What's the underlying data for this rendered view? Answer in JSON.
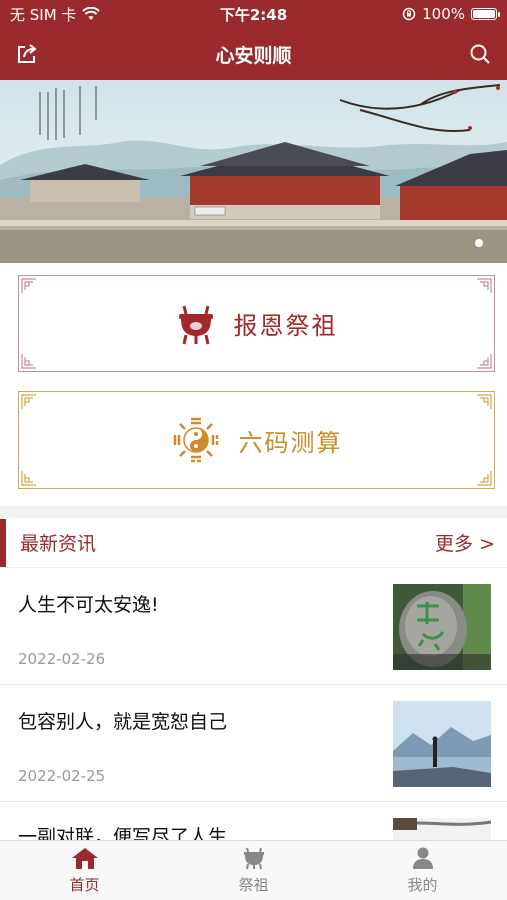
{
  "status": {
    "carrier": "无 SIM 卡",
    "time": "下午2:48",
    "battery": "100%"
  },
  "navbar": {
    "title": "心安则顺",
    "share_icon": "share-icon",
    "search_icon": "search-icon"
  },
  "banner": {
    "image": "temple-landscape-image"
  },
  "cards": [
    {
      "label": "报恩祭祖",
      "icon": "incense-burner-icon",
      "color": "#a3282c"
    },
    {
      "label": "六码测算",
      "icon": "taiji-bagua-icon",
      "color": "#cf8a2a"
    }
  ],
  "news": {
    "title": "最新资讯",
    "more": "更多 >",
    "items": [
      {
        "title": "人生不可太安逸!",
        "date": "2022-02-26"
      },
      {
        "title": "包容别人，就是宽恕自己",
        "date": "2022-02-25"
      },
      {
        "title": "一副对联，便写尽了人生"
      }
    ]
  },
  "tabs": [
    {
      "label": "首页",
      "icon": "home-icon",
      "active": true
    },
    {
      "label": "祭祖",
      "icon": "incense-burner-icon"
    },
    {
      "label": "我的",
      "icon": "user-icon"
    }
  ],
  "colors": {
    "brand": "#9a2a2e",
    "gold": "#cf8a2a"
  }
}
